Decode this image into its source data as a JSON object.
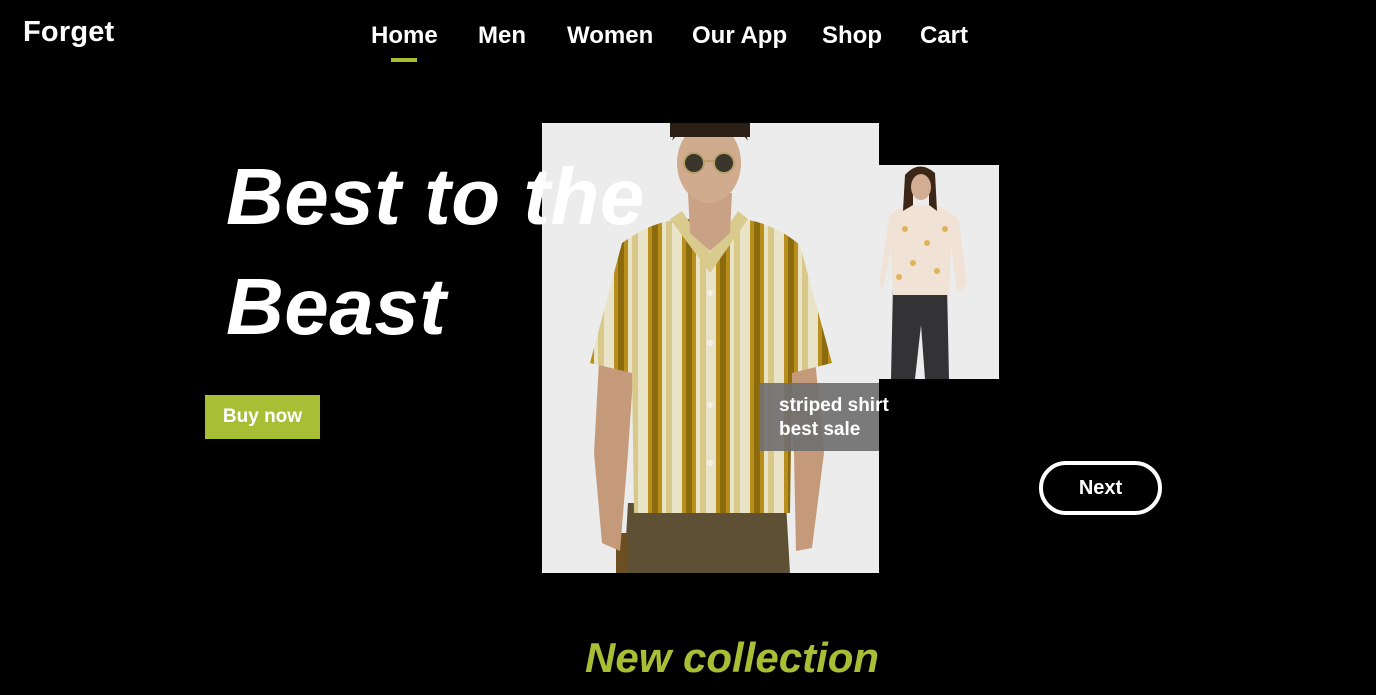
{
  "brand": {
    "logo": "Forget"
  },
  "nav": {
    "items": [
      {
        "label": "Home",
        "active": true
      },
      {
        "label": "Men",
        "active": false
      },
      {
        "label": "Women",
        "active": false
      },
      {
        "label": "Our App",
        "active": false
      },
      {
        "label": "Shop",
        "active": false
      },
      {
        "label": "Cart",
        "active": false
      }
    ],
    "active_color": "#a8bf35"
  },
  "hero": {
    "title_line1": "Best to the",
    "title_line2": "Beast",
    "buy_label": "Buy now",
    "next_label": "Next",
    "caption_line1": "striped shirt",
    "caption_line2": "best sale",
    "main_image": "man-striped-shirt-photo",
    "secondary_image": "woman-floral-blouse-photo"
  },
  "section": {
    "title": "New collection"
  },
  "colors": {
    "accent": "#a8bf35",
    "background": "#000000",
    "photo_bg": "#ececec"
  }
}
